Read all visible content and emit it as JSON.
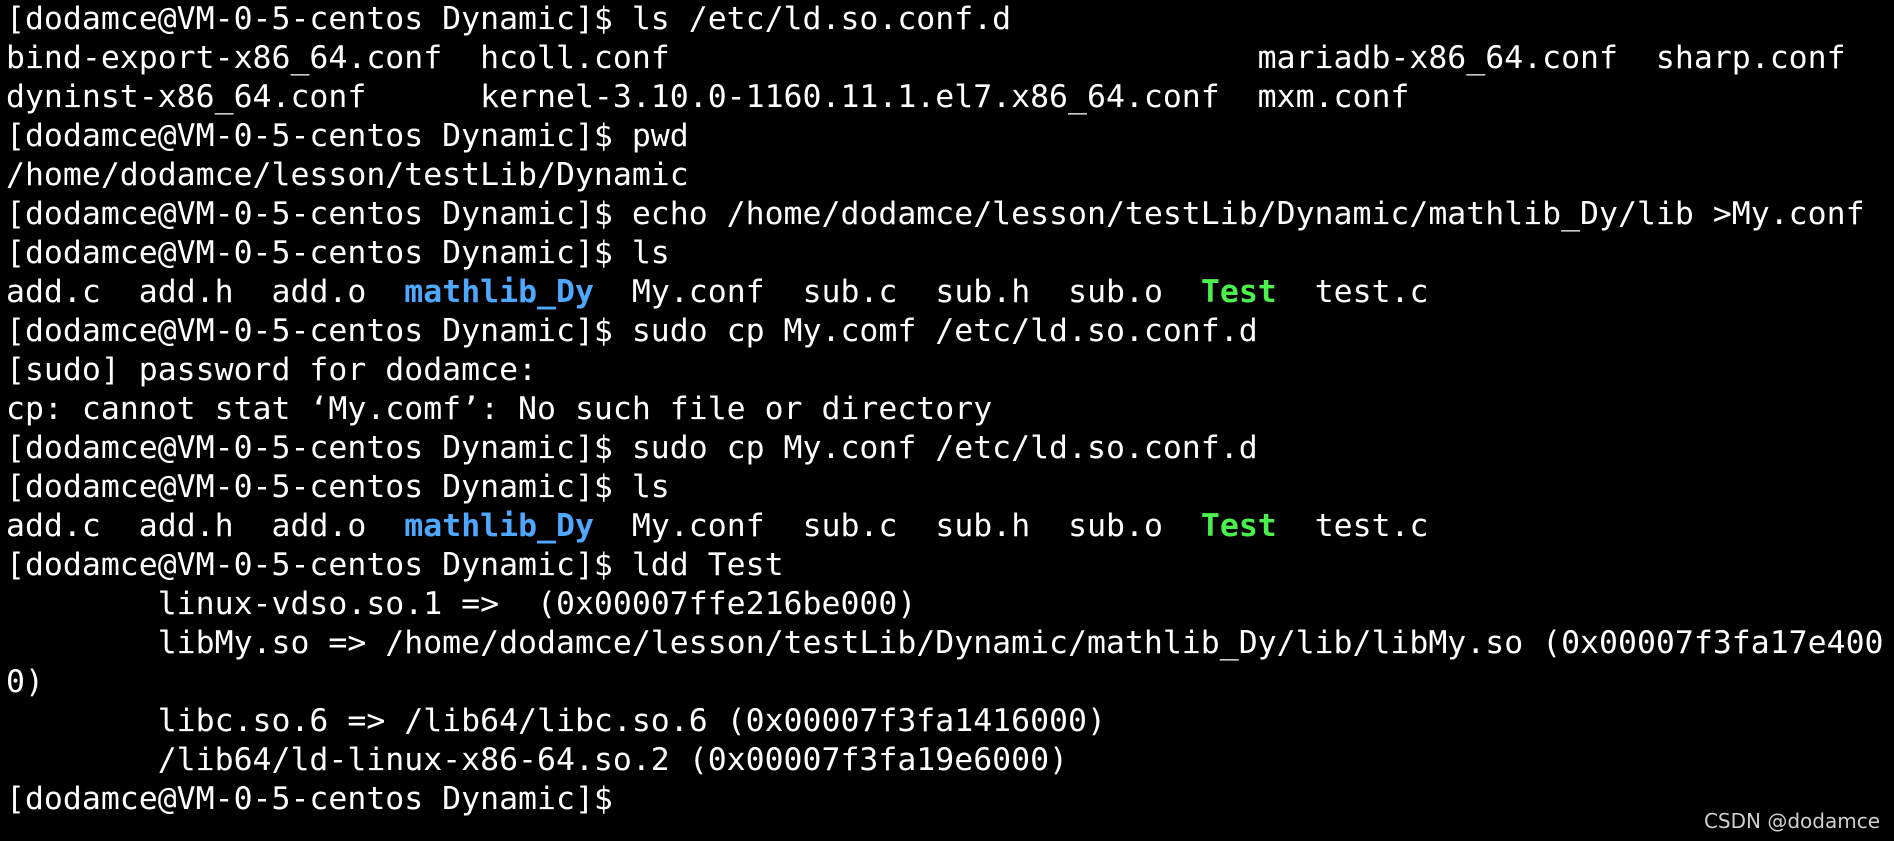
{
  "terminal": {
    "prompt": "[dodamce@VM-0-5-centos Dynamic]$ ",
    "lines": [
      "[dodamce@VM-0-5-centos Dynamic]$ ls /etc/ld.so.conf.d",
      "bind-export-x86_64.conf  hcoll.conf                               mariadb-x86_64.conf  sharp.conf",
      "dyninst-x86_64.conf      kernel-3.10.0-1160.11.1.el7.x86_64.conf  mxm.conf",
      "[dodamce@VM-0-5-centos Dynamic]$ pwd",
      "/home/dodamce/lesson/testLib/Dynamic",
      "[dodamce@VM-0-5-centos Dynamic]$ echo /home/dodamce/lesson/testLib/Dynamic/mathlib_Dy/lib >My.conf",
      "[dodamce@VM-0-5-centos Dynamic]$ ls"
    ],
    "ls_output": {
      "items": [
        {
          "name": "add.c",
          "kind": "file"
        },
        {
          "name": "add.h",
          "kind": "file"
        },
        {
          "name": "add.o",
          "kind": "file"
        },
        {
          "name": "mathlib_Dy",
          "kind": "dir"
        },
        {
          "name": "My.conf",
          "kind": "file"
        },
        {
          "name": "sub.c",
          "kind": "file"
        },
        {
          "name": "sub.h",
          "kind": "file"
        },
        {
          "name": "sub.o",
          "kind": "file"
        },
        {
          "name": "Test",
          "kind": "exe"
        },
        {
          "name": "test.c",
          "kind": "file"
        }
      ]
    },
    "lines2": [
      "[dodamce@VM-0-5-centos Dynamic]$ sudo cp My.comf /etc/ld.so.conf.d",
      "[sudo] password for dodamce:",
      "cp: cannot stat ‘My.comf’: No such file or directory",
      "[dodamce@VM-0-5-centos Dynamic]$ sudo cp My.conf /etc/ld.so.conf.d",
      "[dodamce@VM-0-5-centos Dynamic]$ ls"
    ],
    "lines3": [
      "[dodamce@VM-0-5-centos Dynamic]$ ldd Test",
      "        linux-vdso.so.1 =>  (0x00007ffe216be000)",
      "        libMy.so => /home/dodamce/lesson/testLib/Dynamic/mathlib_Dy/lib/libMy.so (0x00007f3fa17e400",
      "0)",
      "        libc.so.6 => /lib64/libc.so.6 (0x00007f3fa1416000)",
      "        /lib64/ld-linux-x86-64.so.2 (0x00007f3fa19e6000)",
      "[dodamce@VM-0-5-centos Dynamic]$"
    ]
  },
  "watermark": "CSDN @dodamce",
  "colors": {
    "background": "#000000",
    "text": "#ffffff",
    "directory": "#4fa8ff",
    "executable": "#4cf04c"
  }
}
